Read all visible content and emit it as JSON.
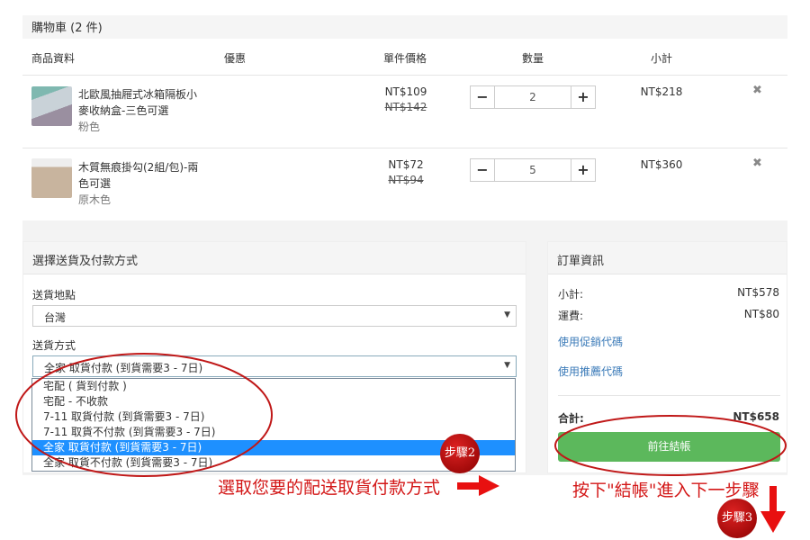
{
  "cart": {
    "title": "購物車 (2 件)",
    "columns": {
      "product": "商品資料",
      "discount": "優惠",
      "unit_price": "單件價格",
      "quantity": "數量",
      "subtotal": "小計"
    },
    "items": [
      {
        "name": "北歐風抽屜式冰箱隔板小麥收納盒-三色可選",
        "variant": "粉色",
        "price": "NT$109",
        "original_price": "NT$142",
        "quantity": "2",
        "subtotal": "NT$218"
      },
      {
        "name": "木質無痕掛勾(2組/包)-兩色可選",
        "variant": "原木色",
        "price": "NT$72",
        "original_price": "NT$94",
        "quantity": "5",
        "subtotal": "NT$360"
      }
    ],
    "minus": "−",
    "plus": "+",
    "remove": "✖"
  },
  "shipping": {
    "title": "選擇送貨及付款方式",
    "location_label": "送貨地點",
    "location_value": "台灣",
    "method_label": "送貨方式",
    "method_value": "全家 取貨付款 (到貨需要3 - 7日)",
    "options": [
      "宅配 ( 貨到付款 )",
      "宅配 - 不收款",
      "7-11 取貨付款 (到貨需要3 - 7日)",
      "7-11 取貨不付款 (到貨需要3 - 7日)",
      "全家 取貨付款 (到貨需要3 - 7日)",
      "全家 取貨不付款 (到貨需要3 - 7日)"
    ],
    "selected_index": 4
  },
  "order": {
    "title": "訂單資訊",
    "subtotal_label": "小計:",
    "subtotal": "NT$578",
    "shipping_label": "運費:",
    "shipping": "NT$80",
    "promo_link": "使用促銷代碼",
    "referral_link": "使用推薦代碼",
    "total_label": "合計:",
    "total": "NT$658",
    "checkout": "前往結帳"
  },
  "annotations": {
    "step2": "步驟2",
    "step2_text": "選取您要的配送取貨付款方式",
    "step3": "步驟3",
    "step3_text": "按下\"結帳\"進入下一步驟"
  },
  "colors": {
    "accent_green": "#5cb85c",
    "highlight": "#1e90ff",
    "annotation_red": "#d31717"
  }
}
